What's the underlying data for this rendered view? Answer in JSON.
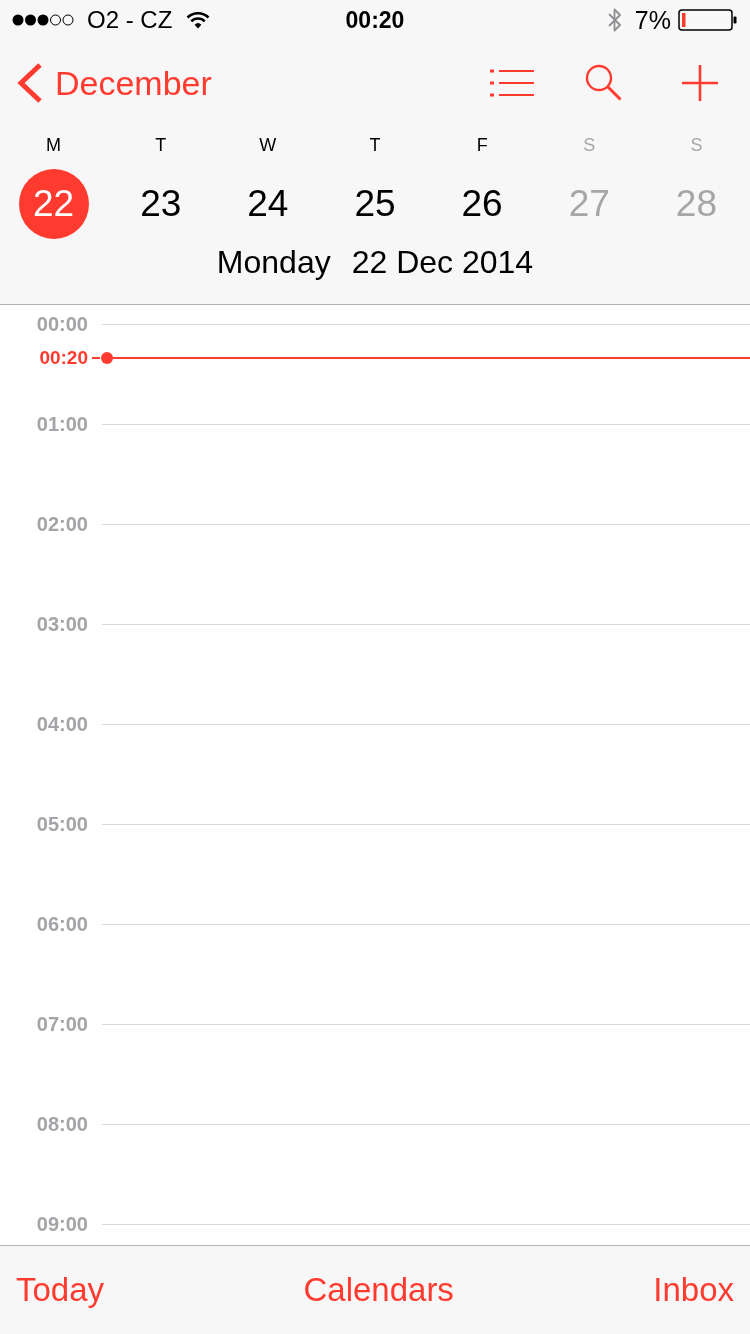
{
  "status_bar": {
    "carrier": "O2 - CZ",
    "time": "00:20",
    "battery": "7%"
  },
  "nav_bar": {
    "back_label": "December"
  },
  "week": {
    "days": [
      {
        "weekday": "M",
        "date": "22",
        "selected": true,
        "dimmed": false
      },
      {
        "weekday": "T",
        "date": "23",
        "selected": false,
        "dimmed": false
      },
      {
        "weekday": "W",
        "date": "24",
        "selected": false,
        "dimmed": false
      },
      {
        "weekday": "T",
        "date": "25",
        "selected": false,
        "dimmed": false
      },
      {
        "weekday": "F",
        "date": "26",
        "selected": false,
        "dimmed": false
      },
      {
        "weekday": "S",
        "date": "27",
        "selected": false,
        "dimmed": true
      },
      {
        "weekday": "S",
        "date": "28",
        "selected": false,
        "dimmed": true
      }
    ]
  },
  "date_title": {
    "day_name": "Monday",
    "date": "22 Dec 2014"
  },
  "timeline": {
    "hours": [
      "00:00",
      "01:00",
      "02:00",
      "03:00",
      "04:00",
      "05:00",
      "06:00",
      "07:00",
      "08:00",
      "09:00"
    ],
    "now_label": "00:20"
  },
  "tab_bar": {
    "items": [
      "Today",
      "Calendars",
      "Inbox"
    ]
  }
}
